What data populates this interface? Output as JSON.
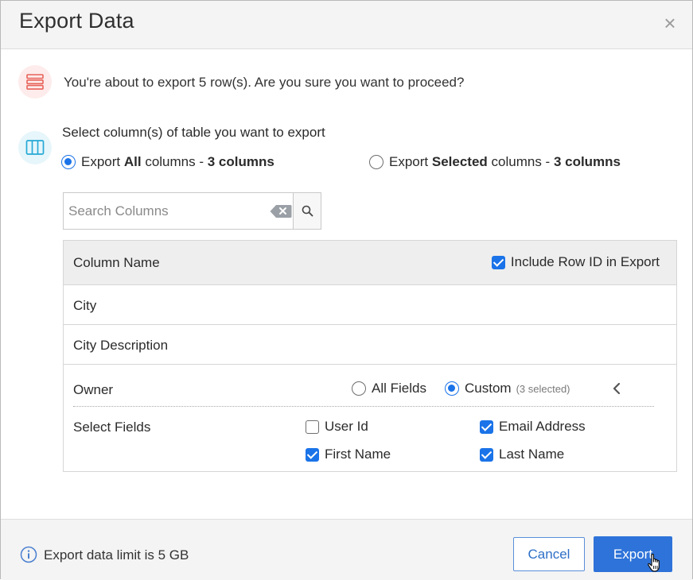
{
  "dialog": {
    "title": "Export Data",
    "close_glyph": "×"
  },
  "confirm": {
    "icon": "rows-icon",
    "message": "You're about to export 5 row(s). Are you sure you want to proceed?"
  },
  "columns_section": {
    "icon": "columns-icon",
    "title": "Select column(s) of table you want to export",
    "options": [
      {
        "prefix": "Export ",
        "bold": "All",
        "middle": " columns - ",
        "count": "3 columns",
        "selected": true
      },
      {
        "prefix": "Export ",
        "bold": "Selected",
        "middle": " columns - ",
        "count": "3 columns",
        "selected": false
      }
    ]
  },
  "search": {
    "placeholder": "Search Columns",
    "value": ""
  },
  "table": {
    "header_name": "Column Name",
    "include_row_id_label": "Include Row ID in Export",
    "include_row_id_checked": true,
    "rows": [
      "City",
      "City Description"
    ],
    "owner": {
      "label": "Owner",
      "option_all": "All Fields",
      "option_custom": "Custom",
      "custom_note": "(3 selected)",
      "selected": "custom",
      "select_fields_label": "Select Fields",
      "fields": [
        {
          "label": "User Id",
          "checked": false
        },
        {
          "label": "Email Address",
          "checked": true
        },
        {
          "label": "First Name",
          "checked": true
        },
        {
          "label": "Last Name",
          "checked": true
        }
      ]
    }
  },
  "footer": {
    "limit_text": "Export data limit is 5 GB",
    "cancel_label": "Cancel",
    "export_label": "Export"
  },
  "colors": {
    "accent": "#1a73e8",
    "primary_button": "#2e73d9",
    "rows_icon": "#e8625a",
    "columns_icon": "#27a9d6"
  }
}
